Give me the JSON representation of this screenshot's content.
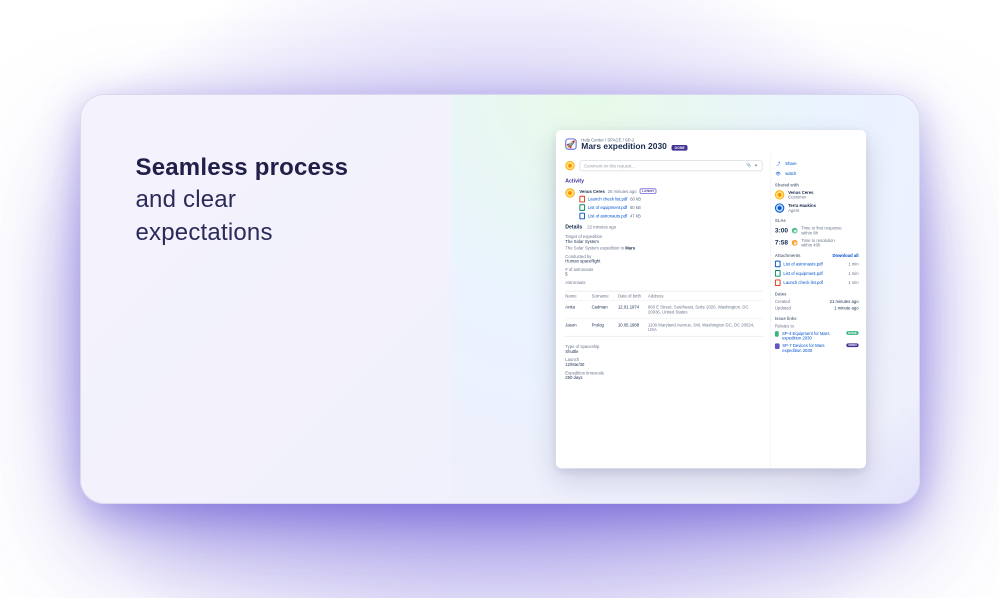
{
  "hero": {
    "line1_strong": "Seamless process",
    "line2": "and clear",
    "line3": "expectations"
  },
  "breadcrumb": "Help Center / SPACE / SP-2",
  "title": "Mars expedition 2030",
  "title_badge": "DONE",
  "comment_placeholder": "Comment on this request...",
  "activity_label": "Activity",
  "activity_author": "Venus Ceres",
  "activity_time": "25 minutes ago",
  "activity_tag": "LATEST",
  "activity_files": [
    {
      "name": "Launch check list.pdf",
      "size": "60 kB",
      "color": "red"
    },
    {
      "name": "List of equipment.pdf",
      "size": "60 kB",
      "color": "green2"
    },
    {
      "name": "List of astronauts.pdf",
      "size": "47 kB",
      "color": "blue2"
    }
  ],
  "details_label": "Details",
  "details_time": "22 minutes ago",
  "fields": {
    "target_l": "Target of expedition",
    "target_v": "The Solar System",
    "desc": "The Solar System expedition to Mars",
    "conducted_l": "Conducted by",
    "conducted_v": "Human spaceflight",
    "num_astro_l": "# of astronauts",
    "num_astro_v": "5",
    "astronauts_l": "Astronauts"
  },
  "table": {
    "headers": [
      "Name",
      "Surname",
      "Date of birth",
      "Address"
    ],
    "rows": [
      {
        "name": "Anita",
        "surname": "Cadman",
        "dob": "12.01.1974",
        "addr": "860 E Street, Southeast, Suite 2020, Washington, DC 20036, United States"
      },
      {
        "name": "Jason",
        "surname": "Prolog",
        "dob": "10.05.1988",
        "addr": "1100 Maryland Avenue, SW, Washington DC, DC 20024, USA"
      }
    ]
  },
  "spaceship": {
    "type_l": "Type of spaceship",
    "type_v": "Shuttle",
    "launch_l": "Launch",
    "launch_v": "12/Mar/30",
    "tl_l": "Expedition timescale",
    "tl_v": "250 days"
  },
  "side": {
    "share": "Share",
    "watch": "watch",
    "shared_with_l": "Shared with",
    "users": [
      {
        "name": "Venus Ceres",
        "role": "Customer",
        "av": "av"
      },
      {
        "name": "Terra Haukins",
        "role": "Agent",
        "av": "av blue"
      }
    ],
    "slas_l": "SLAs",
    "slas": [
      {
        "num": "3:00",
        "unit": "Time to first response",
        "within": "within 8h",
        "cls": "green"
      },
      {
        "num": "7:58",
        "unit": "Time to resolution",
        "within": "within 40h",
        "cls": "orange"
      }
    ],
    "attach_l": "Attachments",
    "download_all": "Download all",
    "attachments": [
      {
        "name": "List of astronauts.pdf",
        "color": "blue2"
      },
      {
        "name": "List of equipment.pdf",
        "color": "green2"
      },
      {
        "name": "Launch check list.pdf",
        "color": "red"
      }
    ],
    "time_each": "1 min",
    "dates_l": "Dates",
    "created_l": "Created",
    "created_v": "21 minutes ago",
    "updated_l": "Updated",
    "updated_v": "1 minute ago",
    "links_l": "Issue links",
    "relates_l": "Relates to",
    "links": [
      {
        "sq": "green",
        "key": "SP-4",
        "text": "Equipment for Mars expedition 2030",
        "pill": "DONE",
        "pillcls": "done-pill"
      },
      {
        "sq": "purple",
        "key": "SP-7",
        "text": "Devices for Mars expedition 2030",
        "pill": "OPEN",
        "pillcls": "open-pill"
      }
    ]
  }
}
